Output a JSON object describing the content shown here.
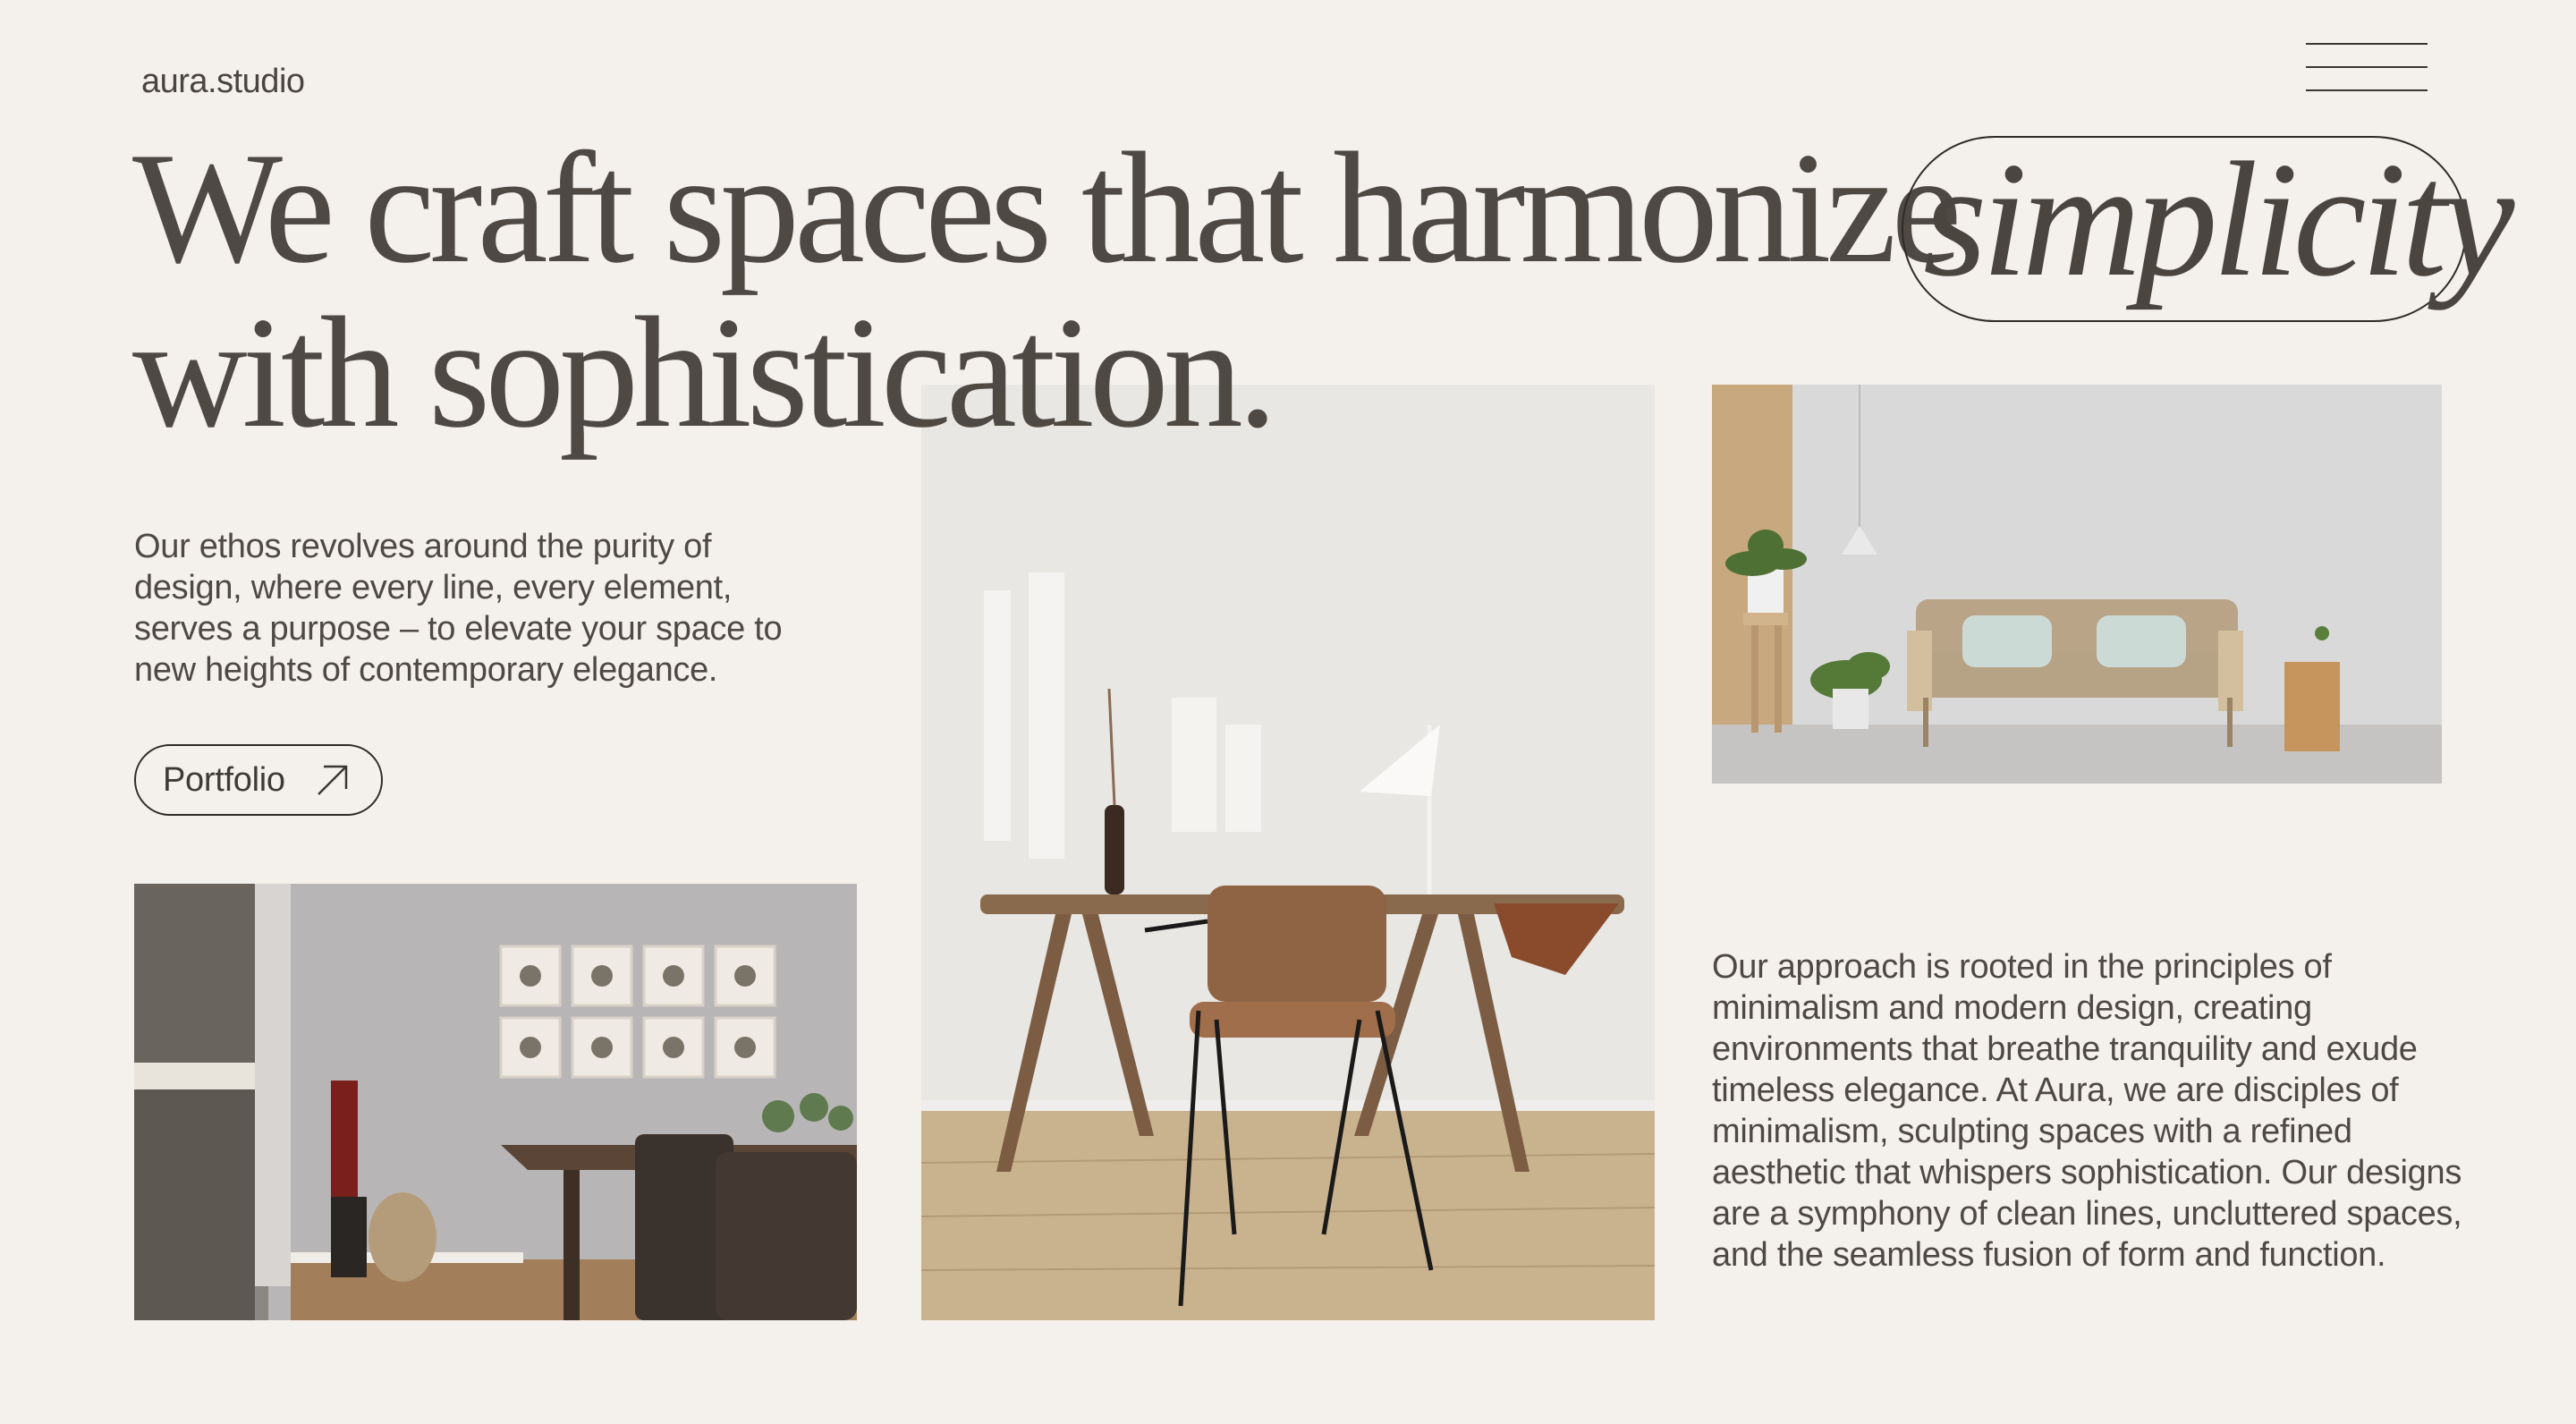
{
  "brand": {
    "logo_text": "aura.studio"
  },
  "nav": {
    "menu_icon": "hamburger-menu-icon"
  },
  "hero": {
    "headline_line1": "We craft spaces that harmonize",
    "highlight_word": "simplicity",
    "headline_line2": "with sophistication."
  },
  "intro": {
    "paragraph": "Our ethos revolves around the purity of design, where every line, every element, serves a purpose – to elevate your space to new heights of contemporary elegance.",
    "button_label": "Portfolio",
    "button_icon": "arrow-up-right-icon"
  },
  "approach": {
    "paragraph": "Our approach is rooted in the principles of minimalism and modern design, creating environments that breathe tranquility and exude timeless elegance. At Aura, we are disciples of minimalism, sculpting spaces with a refined aesthetic that whispers sophistication. Our designs are a symphony of clean lines, uncluttered spaces, and the seamless fusion of form and function."
  },
  "images": {
    "dining": "dining-room-photo",
    "desk": "desk-workspace-photo",
    "sofa": "living-room-sofa-photo"
  },
  "colors": {
    "background": "#f4f1ed",
    "text": "#4e4943",
    "outline": "#2f2b27"
  }
}
